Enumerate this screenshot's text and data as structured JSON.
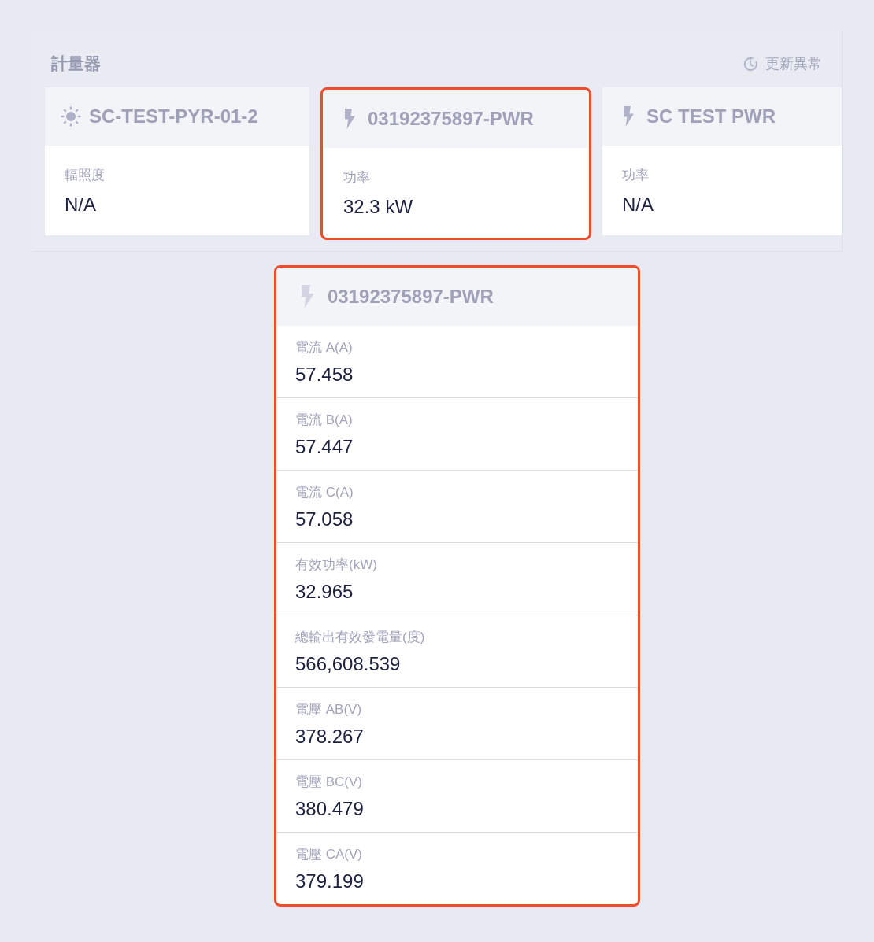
{
  "panel": {
    "title": "計量器",
    "status": {
      "label": "更新異常"
    }
  },
  "meters": [
    {
      "kind": "irradiance",
      "name": "SC-TEST-PYR-01-2",
      "metric_label": "輻照度",
      "metric_value": "N/A",
      "selected": false
    },
    {
      "kind": "power",
      "name": "03192375897-PWR",
      "metric_label": "功率",
      "metric_value": "32.3 kW",
      "selected": true
    },
    {
      "kind": "power",
      "name": "SC TEST PWR",
      "metric_label": "功率",
      "metric_value": "N/A",
      "selected": false
    }
  ],
  "detail": {
    "kind": "power",
    "name": "03192375897-PWR",
    "highlighted": true,
    "rows": [
      {
        "label": "電流 A(A)",
        "value": "57.458"
      },
      {
        "label": "電流 B(A)",
        "value": "57.447"
      },
      {
        "label": "電流 C(A)",
        "value": "57.058"
      },
      {
        "label": "有效功率(kW)",
        "value": "32.965"
      },
      {
        "label": "總輸出有效發電量(度)",
        "value": "566,608.539"
      },
      {
        "label": "電壓 AB(V)",
        "value": "378.267"
      },
      {
        "label": "電壓 BC(V)",
        "value": "380.479"
      },
      {
        "label": "電壓 CA(V)",
        "value": "379.199"
      }
    ]
  }
}
